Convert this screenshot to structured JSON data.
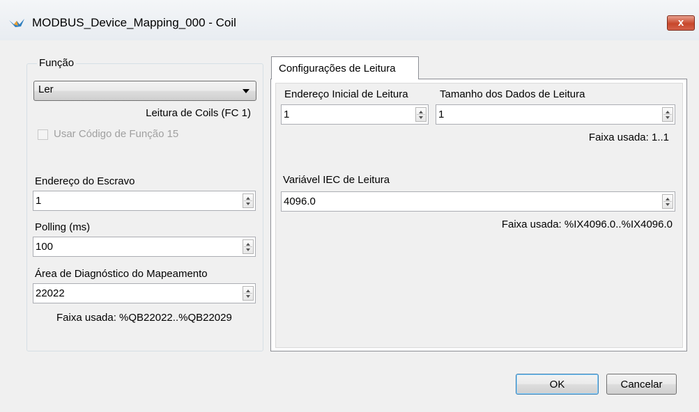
{
  "window": {
    "title": "MODBUS_Device_Mapping_000 - Coil",
    "close_label": "x"
  },
  "funcao": {
    "group_label": "Função",
    "select_value": "Ler",
    "function_desc": "Leitura de Coils (FC 1)",
    "checkbox_label": "Usar Código de Função 15",
    "checkbox_checked": false
  },
  "slave": {
    "label": "Endereço do Escravo",
    "value": "1"
  },
  "polling": {
    "label": "Polling (ms)",
    "value": "100"
  },
  "diagnostico": {
    "label": "Área de Diagnóstico do Mapeamento",
    "value": "22022",
    "range": "Faixa usada: %QB22022..%QB22029"
  },
  "tab": {
    "label": "Configurações de Leitura"
  },
  "leitura": {
    "start_label": "Endereço Inicial de Leitura",
    "start_value": "1",
    "size_label": "Tamanho dos Dados de Leitura",
    "size_value": "1",
    "size_range": "Faixa usada: 1..1",
    "var_label": "Variável IEC de Leitura",
    "var_value": "4096.0",
    "var_range": "Faixa usada: %IX4096.0..%IX4096.0"
  },
  "buttons": {
    "ok": "OK",
    "cancel": "Cancelar"
  },
  "icons": {
    "app": "bird-logo-icon",
    "close": "close-icon",
    "dropdown": "chevron-down-icon",
    "spin": "spinner-arrows-icon"
  },
  "colors": {
    "close_red": "#c7472b",
    "default_button_border": "#3c7fb1"
  }
}
